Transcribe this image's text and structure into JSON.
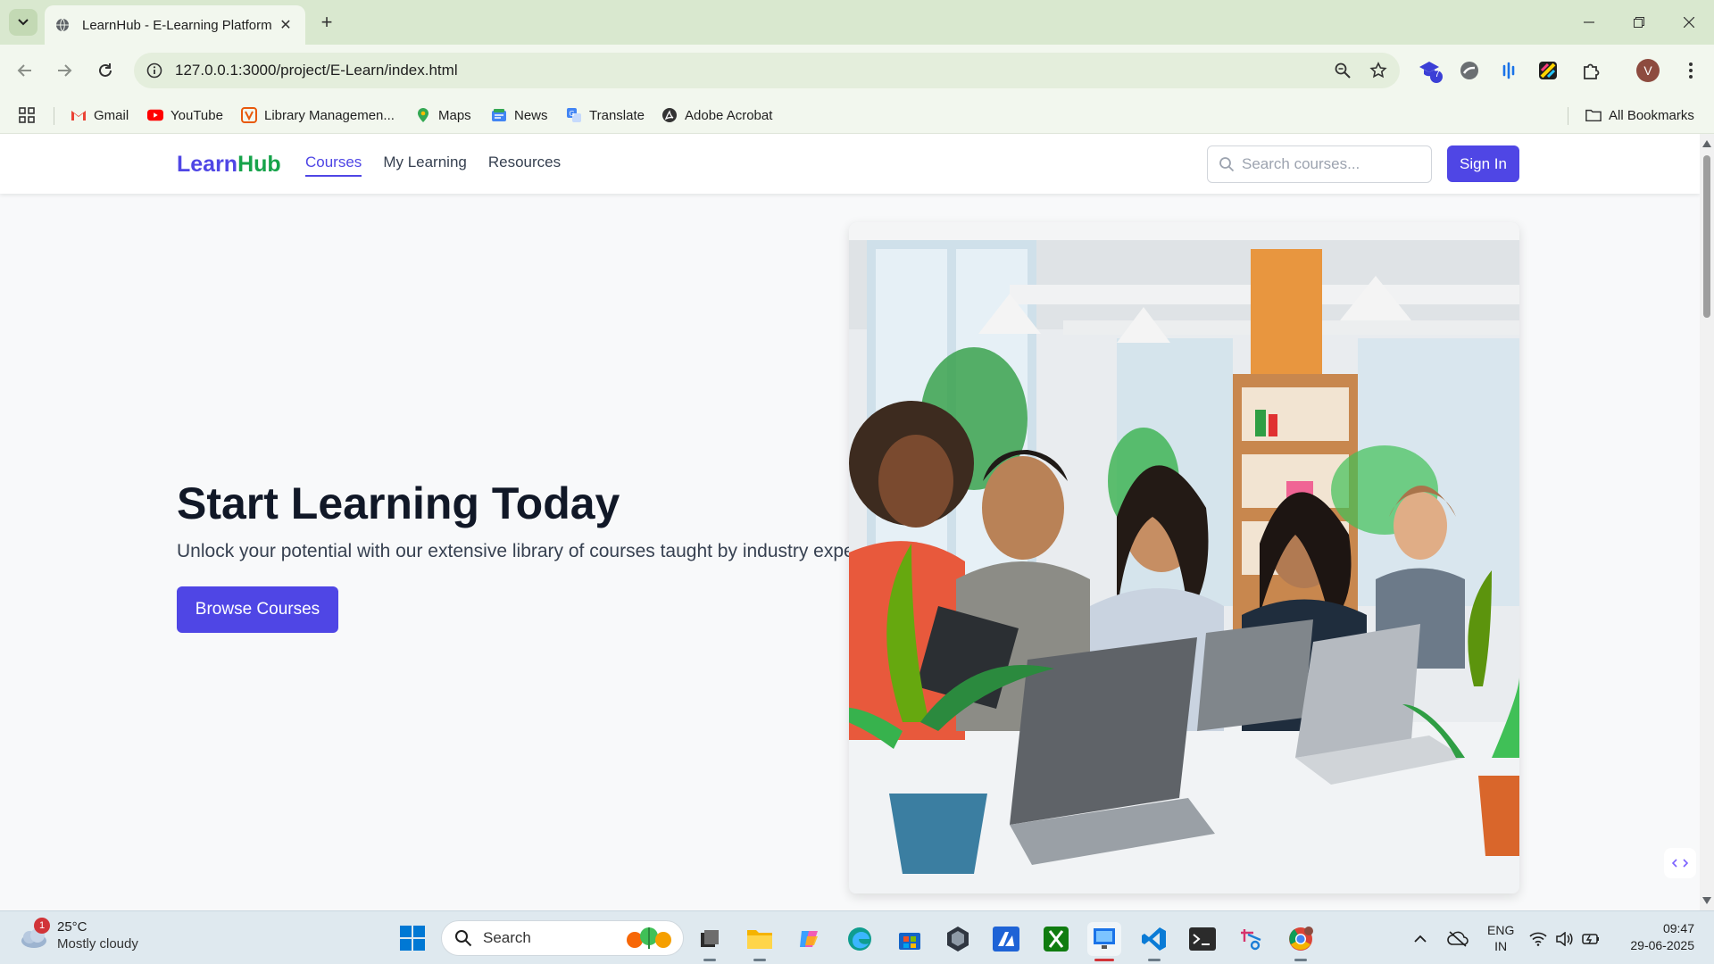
{
  "browser": {
    "tab_title": "LearnHub - E-Learning Platform",
    "url": "127.0.0.1:3000/project/E-Learn/index.html",
    "extension_badge": "7",
    "profile_initial": "V"
  },
  "bookmarks": {
    "items": [
      {
        "label": "Gmail",
        "icon": "gmail-icon"
      },
      {
        "label": "YouTube",
        "icon": "youtube-icon"
      },
      {
        "label": "Library Managemen...",
        "icon": "library-icon"
      },
      {
        "label": "Maps",
        "icon": "maps-icon"
      },
      {
        "label": "News",
        "icon": "news-icon"
      },
      {
        "label": "Translate",
        "icon": "translate-icon"
      },
      {
        "label": "Adobe Acrobat",
        "icon": "acrobat-icon"
      }
    ],
    "all_bookmarks": "All Bookmarks"
  },
  "site": {
    "logo_part1": "Learn",
    "logo_part2": "Hub",
    "nav": [
      "Courses",
      "My Learning",
      "Resources"
    ],
    "active_nav": "Courses",
    "search_placeholder": "Search courses...",
    "signin_label": "Sign In",
    "accent": "#4f46e5",
    "logo_green": "#16a34a"
  },
  "hero": {
    "title": "Start Learning Today",
    "subtitle": "Unlock your potential with our extensive library of courses taught by industry experts.",
    "cta": "Browse Courses",
    "image": "students-with-laptops-photo"
  },
  "taskbar": {
    "weather_badge": "1",
    "temperature": "25°C",
    "condition": "Mostly cloudy",
    "search_label": "Search",
    "lang_line1": "ENG",
    "lang_line2": "IN",
    "time": "09:47",
    "date": "29-06-2025"
  }
}
